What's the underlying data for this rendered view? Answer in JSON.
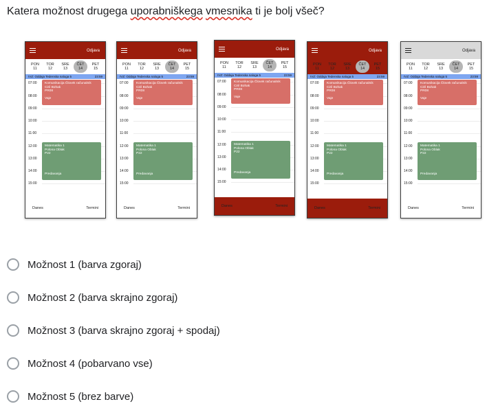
{
  "question": {
    "part1": "Katera možnost drugega ",
    "word_uporabniskega": "uporabniškega",
    "part2": " ",
    "word_vmesnika": "vmesnika",
    "part3": " ti je bolj všeč?"
  },
  "mockup": {
    "logout": "Odjava",
    "days": [
      {
        "name": "PON",
        "num": "11"
      },
      {
        "name": "TOR",
        "num": "12"
      },
      {
        "name": "SRE",
        "num": "13"
      },
      {
        "name": "ČET",
        "num": "14"
      },
      {
        "name": "PET",
        "num": "15"
      }
    ],
    "notice_text": "IVZ: Oddaja Tedenska naloga 5",
    "notice_time": "23:59",
    "hours": [
      "07:00",
      "08:00",
      "09:00",
      "10:00",
      "11:00",
      "12:00",
      "13:00",
      "14:00",
      "15:00"
    ],
    "event1": {
      "title": "Komunikacija Človek računalnik",
      "person": "Ciril Bohak",
      "room": "PR08",
      "type": "Vaje"
    },
    "event2": {
      "title": "Matematika 1",
      "person": "Polona Oblak",
      "room": "P22",
      "type": "Predavanja"
    },
    "today": "Danes",
    "appointments": "Termini"
  },
  "colors": {
    "brand_red": "#9b1c0c",
    "light_grey": "#d9d9d9",
    "event_red": "#d76f68",
    "event_green": "#6f9d74",
    "notice_blue": "#7ea6f0"
  },
  "options": [
    "Možnost 1 (barva zgoraj)",
    "Možnost 2 (barva skrajno zgoraj)",
    "Možnost 3 (barva skrajno zgoraj + spodaj)",
    "Možnost 4 (pobarvano vse)",
    "Možnost 5 (brez barve)"
  ]
}
